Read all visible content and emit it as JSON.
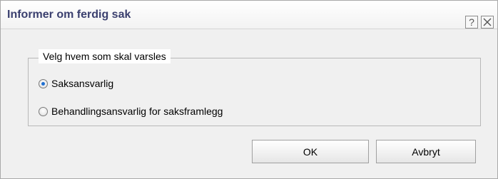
{
  "dialog": {
    "title": "Informer om ferdig sak",
    "help_label": "?",
    "close_icon": "close-icon"
  },
  "group": {
    "legend": "Velg hvem som skal varsles",
    "options": [
      {
        "label": "Saksansvarlig",
        "selected": true
      },
      {
        "label": "Behandlingsansvarlig for saksframlegg",
        "selected": false
      }
    ]
  },
  "buttons": {
    "ok_label": "OK",
    "cancel_label": "Avbryt"
  },
  "colors": {
    "title_text": "#3a3f6e",
    "radio_selected": "#1f6fd1"
  }
}
